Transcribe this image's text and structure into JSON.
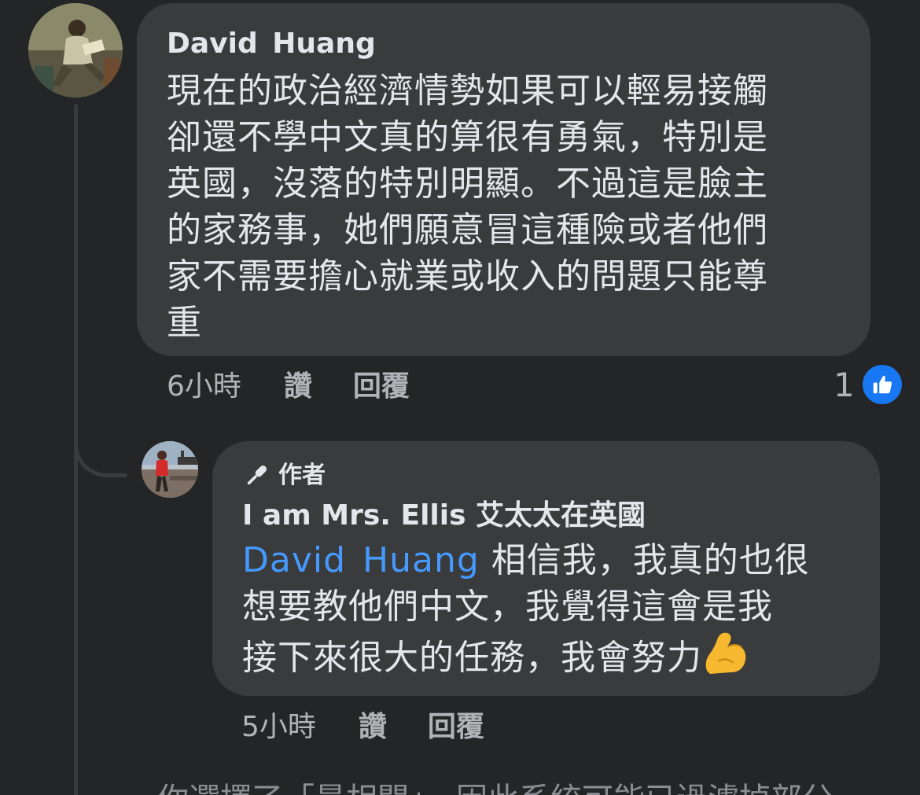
{
  "main_comment": {
    "author": "David  Huang",
    "text_lines": [
      "現在的政治經濟情勢如果可以輕易接觸",
      "卻還不學中文真的算很有勇氣，特別是",
      "英國，沒落的特別明顯。不過這是臉主",
      "的家務事，她們願意冒這種險或者他們",
      "家不需要擔心就業或收入的問題只能尊",
      "重"
    ],
    "time": "6小時",
    "like_label": "讚",
    "reply_label": "回覆",
    "reaction_count": "1",
    "reaction_icon": "thumbs-up-icon"
  },
  "reply_comment": {
    "badge_label": "作者",
    "badge_icon": "microphone-icon",
    "author": "I am Mrs. Ellis 艾太太在英國",
    "mention": "David  Huang",
    "text_lines": [
      "相信我，我真的也很",
      "想要教他們中文，我覺得這會是我",
      "接下來很大的任務，我會努力"
    ],
    "emoji": "flexed-biceps-emoji",
    "time": "5小時",
    "like_label": "讚",
    "reply_label": "回覆"
  },
  "filter_notice": "你選擇了「最相關」，因此系統可能已過濾掉部分",
  "colors": {
    "background": "#242526",
    "bubble": "#3a3b3c",
    "text": "#e4e6eb",
    "secondary_text": "#b0b3b8",
    "mention": "#4599ff",
    "like_badge": "#1877f2"
  }
}
